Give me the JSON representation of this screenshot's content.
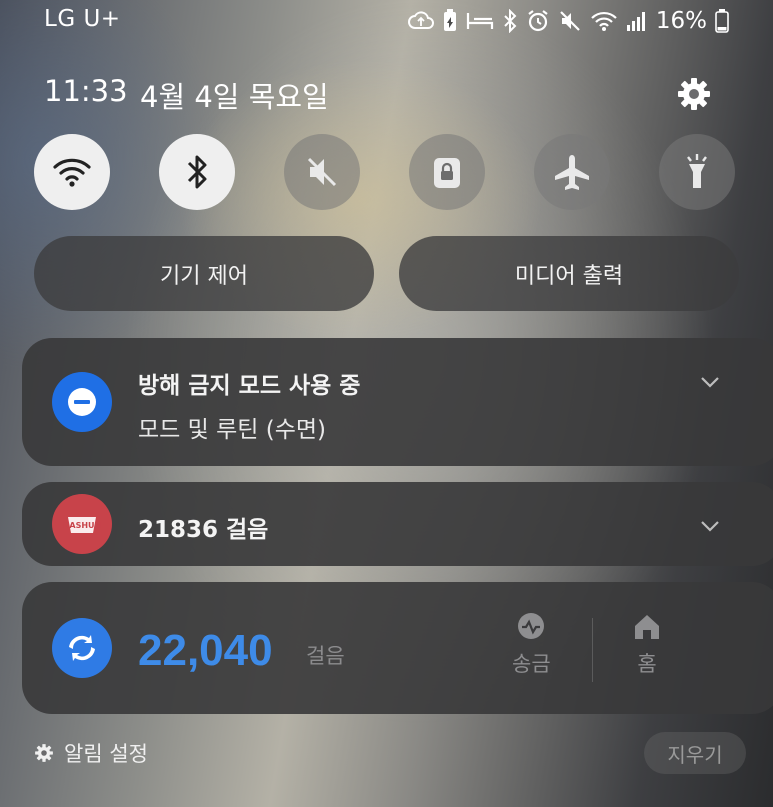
{
  "status_bar": {
    "carrier": "LG U+",
    "battery_percent": "16%",
    "icons": [
      "cloud-sync-icon",
      "battery-saver-icon",
      "sleep-mode-icon",
      "bluetooth-icon",
      "alarm-icon",
      "mute-icon",
      "wifi-icon",
      "signal-icon",
      "battery-icon"
    ]
  },
  "header": {
    "time": "11:33",
    "date": "4월 4일 목요일"
  },
  "quick_settings": [
    {
      "name": "wifi-icon",
      "state": "on"
    },
    {
      "name": "bluetooth-icon",
      "state": "on"
    },
    {
      "name": "mute-icon",
      "state": "off"
    },
    {
      "name": "lock-icon",
      "state": "off"
    },
    {
      "name": "airplane-icon",
      "state": "off"
    },
    {
      "name": "flashlight-icon",
      "state": "off"
    }
  ],
  "buttons": {
    "device_control": "기기 제어",
    "media_output": "미디어 출력"
  },
  "notifications": {
    "dnd": {
      "title": "방해 금지 모드 사용 중",
      "subtitle": "모드 및 루틴 (수면)",
      "icon_color": "#1f6fe5"
    },
    "app_steps": {
      "title": "21836 걸음",
      "icon_label": "DASHUN",
      "icon_color": "#c8434a"
    },
    "pay_steps": {
      "value": "22,040",
      "unit": "걸음",
      "accent": "#3e8be8",
      "actions": [
        "송금",
        "홈"
      ]
    }
  },
  "footer": {
    "notification_settings": "알림 설정",
    "clear": "지우기"
  }
}
